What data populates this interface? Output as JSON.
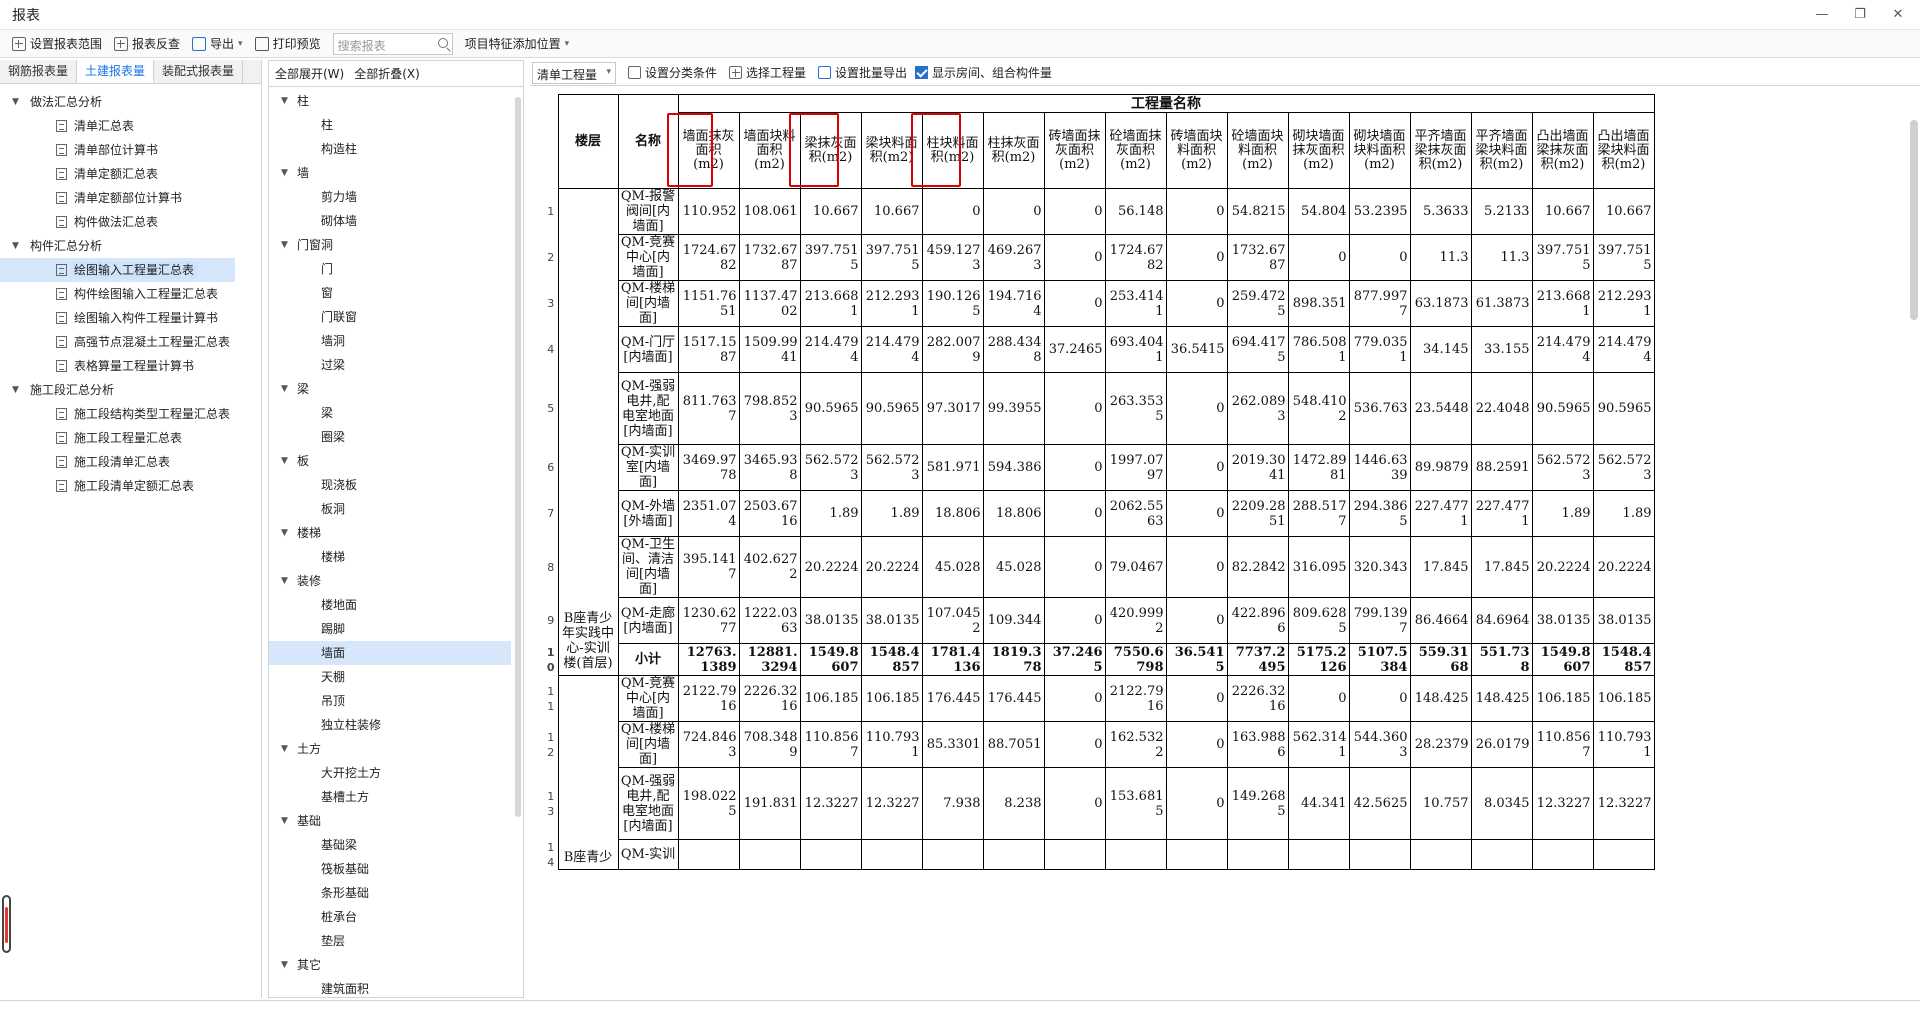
{
  "window": {
    "title": "报表",
    "min": "—",
    "restore": "❐",
    "close": "✕"
  },
  "toolbar": {
    "set_range": "设置报表范围",
    "reverse": "报表反查",
    "export": "导出",
    "print_preview": "打印预览",
    "search_placeholder": "搜索报表",
    "add_feature_position": "项目特征添加位置"
  },
  "left_tabs": [
    "钢筋报表量",
    "土建报表量",
    "装配式报表量"
  ],
  "left_tree": [
    {
      "type": "group",
      "label": "做法汇总分析"
    },
    {
      "type": "leaf",
      "label": "清单汇总表"
    },
    {
      "type": "leaf",
      "label": "清单部位计算书"
    },
    {
      "type": "leaf",
      "label": "清单定额汇总表"
    },
    {
      "type": "leaf",
      "label": "清单定额部位计算书"
    },
    {
      "type": "leaf",
      "label": "构件做法汇总表"
    },
    {
      "type": "group",
      "label": "构件汇总分析"
    },
    {
      "type": "leaf",
      "label": "绘图输入工程量汇总表",
      "selected": true
    },
    {
      "type": "leaf",
      "label": "构件绘图输入工程量汇总表"
    },
    {
      "type": "leaf",
      "label": "绘图输入构件工程量计算书"
    },
    {
      "type": "leaf",
      "label": "高强节点混凝土工程量汇总表"
    },
    {
      "type": "leaf",
      "label": "表格算量工程量计算书"
    },
    {
      "type": "group",
      "label": "施工段汇总分析"
    },
    {
      "type": "leaf",
      "label": "施工段结构类型工程量汇总表"
    },
    {
      "type": "leaf",
      "label": "施工段工程量汇总表"
    },
    {
      "type": "leaf",
      "label": "施工段清单汇总表"
    },
    {
      "type": "leaf",
      "label": "施工段清单定额汇总表"
    }
  ],
  "mid_head": {
    "expand_all": "全部展开(W)",
    "collapse_all": "全部折叠(X)"
  },
  "mid_tree": [
    {
      "type": "group",
      "label": "柱"
    },
    {
      "type": "leaf",
      "label": "柱"
    },
    {
      "type": "leaf",
      "label": "构造柱"
    },
    {
      "type": "group",
      "label": "墙"
    },
    {
      "type": "leaf",
      "label": "剪力墙"
    },
    {
      "type": "leaf",
      "label": "砌体墙"
    },
    {
      "type": "group",
      "label": "门窗洞"
    },
    {
      "type": "leaf",
      "label": "门"
    },
    {
      "type": "leaf",
      "label": "窗"
    },
    {
      "type": "leaf",
      "label": "门联窗"
    },
    {
      "type": "leaf",
      "label": "墙洞"
    },
    {
      "type": "leaf",
      "label": "过梁"
    },
    {
      "type": "group",
      "label": "梁"
    },
    {
      "type": "leaf",
      "label": "梁"
    },
    {
      "type": "leaf",
      "label": "圈梁"
    },
    {
      "type": "group",
      "label": "板"
    },
    {
      "type": "leaf",
      "label": "现浇板"
    },
    {
      "type": "leaf",
      "label": "板洞"
    },
    {
      "type": "group",
      "label": "楼梯"
    },
    {
      "type": "leaf",
      "label": "楼梯"
    },
    {
      "type": "group",
      "label": "装修"
    },
    {
      "type": "leaf",
      "label": "楼地面"
    },
    {
      "type": "leaf",
      "label": "踢脚"
    },
    {
      "type": "leaf",
      "label": "墙面",
      "selected": true
    },
    {
      "type": "leaf",
      "label": "天棚"
    },
    {
      "type": "leaf",
      "label": "吊顶"
    },
    {
      "type": "leaf",
      "label": "独立柱装修"
    },
    {
      "type": "group",
      "label": "土方"
    },
    {
      "type": "leaf",
      "label": "大开挖土方"
    },
    {
      "type": "leaf",
      "label": "基槽土方"
    },
    {
      "type": "group",
      "label": "基础"
    },
    {
      "type": "leaf",
      "label": "基础梁"
    },
    {
      "type": "leaf",
      "label": "筏板基础"
    },
    {
      "type": "leaf",
      "label": "条形基础"
    },
    {
      "type": "leaf",
      "label": "桩承台"
    },
    {
      "type": "leaf",
      "label": "垫层"
    },
    {
      "type": "group",
      "label": "其它"
    },
    {
      "type": "leaf",
      "label": "建筑面积"
    }
  ],
  "right_toolbar": {
    "quantity_select": "清单工程量",
    "set_classification": "设置分类条件",
    "select_quantity": "选择工程量",
    "batch_export": "设置批量导出",
    "show_rooms": "显示房间、组合构件量"
  },
  "table": {
    "group_header": "工程量名称",
    "floor_header": "楼层",
    "name_header": "名称",
    "columns": [
      "墙面抹灰面积(m2)",
      "墙面块料面积(m2)",
      "梁抹灰面积(m2)",
      "梁块料面积(m2)",
      "柱块料面积(m2)",
      "柱抹灰面积(m2)",
      "砖墙面抹灰面积(m2)",
      "砼墙面抹灰面积(m2)",
      "砖墙面块料面积(m2)",
      "砼墙面块料面积(m2)",
      "砌块墙面抹灰面积(m2)",
      "砌块墙面块料面积(m2)",
      "平齐墙面梁抹灰面积(m2)",
      "平齐墙面梁块料面积(m2)",
      "凸出墙面梁抹灰面积(m2)",
      "凸出墙面梁块料面积(m2)"
    ],
    "floor_label_1": "B座青少年实践中心-实训楼(首层)",
    "floor_label_2": "B座青少",
    "rows": [
      {
        "n": "1",
        "name": "QM-报警阀间[内墙面]",
        "v": [
          "110.952",
          "108.061",
          "10.667",
          "10.667",
          "0",
          "0",
          "0",
          "56.148",
          "0",
          "54.8215",
          "54.804",
          "53.2395",
          "5.3633",
          "5.2133",
          "10.667",
          "10.667"
        ]
      },
      {
        "n": "2",
        "name": "QM-竞赛中心[内墙面]",
        "v": [
          "1724.6782",
          "1732.6787",
          "397.7515",
          "397.7515",
          "459.1273",
          "469.2673",
          "0",
          "1724.6782",
          "0",
          "1732.6787",
          "0",
          "0",
          "11.3",
          "11.3",
          "397.7515",
          "397.7515"
        ]
      },
      {
        "n": "3",
        "name": "QM-楼梯间[内墙面]",
        "v": [
          "1151.7651",
          "1137.4702",
          "213.6681",
          "212.2931",
          "190.1265",
          "194.7164",
          "0",
          "253.4141",
          "0",
          "259.4725",
          "898.351",
          "877.9977",
          "63.1873",
          "61.3873",
          "213.6681",
          "212.2931"
        ]
      },
      {
        "n": "4",
        "name": "QM-门厅[内墙面]",
        "v": [
          "1517.1587",
          "1509.9941",
          "214.4794",
          "214.4794",
          "282.0079",
          "288.4348",
          "37.2465",
          "693.4041",
          "36.5415",
          "694.4175",
          "786.5081",
          "779.0351",
          "34.145",
          "33.155",
          "214.4794",
          "214.4794"
        ]
      },
      {
        "n": "5",
        "name": "QM-强弱电井,配电室地面[内墙面]",
        "v": [
          "811.7637",
          "798.8523",
          "90.5965",
          "90.5965",
          "97.3017",
          "99.3955",
          "0",
          "263.3535",
          "0",
          "262.0893",
          "548.4102",
          "536.763",
          "23.5448",
          "22.4048",
          "90.5965",
          "90.5965"
        ]
      },
      {
        "n": "6",
        "name": "QM-实训室[内墙面]",
        "v": [
          "3469.9778",
          "3465.938",
          "562.5723",
          "562.5723",
          "581.971",
          "594.386",
          "0",
          "1997.0797",
          "0",
          "2019.3041",
          "1472.8981",
          "1446.6339",
          "89.9879",
          "88.2591",
          "562.5723",
          "562.5723"
        ]
      },
      {
        "n": "7",
        "name": "QM-外墙[外墙面]",
        "v": [
          "2351.074",
          "2503.6716",
          "1.89",
          "1.89",
          "18.806",
          "18.806",
          "0",
          "2062.5563",
          "0",
          "2209.2851",
          "288.5177",
          "294.3865",
          "227.4771",
          "227.4771",
          "1.89",
          "1.89"
        ]
      },
      {
        "n": "8",
        "name": "QM-卫生间、清洁间[内墙面]",
        "v": [
          "395.1417",
          "402.6272",
          "20.2224",
          "20.2224",
          "45.028",
          "45.028",
          "0",
          "79.0467",
          "0",
          "82.2842",
          "316.095",
          "320.343",
          "17.845",
          "17.845",
          "20.2224",
          "20.2224"
        ]
      },
      {
        "n": "9",
        "name": "QM-走廊[内墙面]",
        "v": [
          "1230.6277",
          "1222.0363",
          "38.0135",
          "38.0135",
          "107.0452",
          "109.344",
          "0",
          "420.9992",
          "0",
          "422.8966",
          "809.6285",
          "799.1397",
          "86.4664",
          "84.6964",
          "38.0135",
          "38.0135"
        ]
      },
      {
        "n": "10",
        "name": "小计",
        "subtotal": true,
        "v": [
          "12763.1389",
          "12881.3294",
          "1549.8607",
          "1548.4857",
          "1781.4136",
          "1819.378",
          "37.2465",
          "7550.6798",
          "36.5415",
          "7737.2495",
          "5175.2126",
          "5107.5384",
          "559.3168",
          "551.738",
          "1549.8607",
          "1548.4857"
        ]
      },
      {
        "n": "11",
        "name": "QM-竞赛中心[内墙面]",
        "v": [
          "2122.7916",
          "2226.3216",
          "106.185",
          "106.185",
          "176.445",
          "176.445",
          "0",
          "2122.7916",
          "0",
          "2226.3216",
          "0",
          "0",
          "148.425",
          "148.425",
          "106.185",
          "106.185"
        ]
      },
      {
        "n": "12",
        "name": "QM-楼梯间[内墙面]",
        "v": [
          "724.8463",
          "708.3489",
          "110.8567",
          "110.7931",
          "85.3301",
          "88.7051",
          "0",
          "162.5322",
          "0",
          "163.9886",
          "562.3141",
          "544.3603",
          "28.2379",
          "26.0179",
          "110.8567",
          "110.7931"
        ]
      },
      {
        "n": "13",
        "name": "QM-强弱电井,配电室地面[内墙面]",
        "v": [
          "198.0225",
          "191.831",
          "12.3227",
          "12.3227",
          "7.938",
          "8.238",
          "0",
          "153.6815",
          "0",
          "149.2685",
          "44.341",
          "42.5625",
          "10.757",
          "8.0345",
          "12.3227",
          "12.3227"
        ]
      },
      {
        "n": "14",
        "name": "QM-实训",
        "v": [
          "",
          "",
          "",
          "",
          "",
          "",
          "",
          "",
          "",
          "",
          "",
          "",
          "",
          "",
          "",
          ""
        ]
      }
    ]
  }
}
